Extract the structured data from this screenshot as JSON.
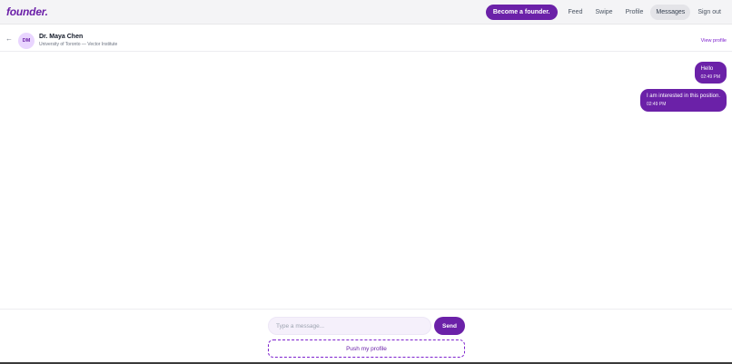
{
  "brand": {
    "logo": "founder."
  },
  "nav": {
    "cta": "Become a founder.",
    "feed": "Feed",
    "swipe": "Swipe",
    "profile": "Profile",
    "messages": "Messages",
    "sign_out": "Sign out",
    "active": "Messages"
  },
  "chat_header": {
    "back": "←",
    "avatar_initials": "DM",
    "name": "Dr. Maya Chen",
    "subtitle": "University of Toronto — Vector Institute",
    "view_profile": "View profile"
  },
  "messages": [
    {
      "text": "Hello",
      "time": "02:49 PM",
      "from": "me"
    },
    {
      "text": "I am interested in this position.",
      "time": "02:49 PM",
      "from": "me"
    }
  ],
  "composer": {
    "placeholder": "Type a message...",
    "send_label": "Send",
    "push_label": "Push my profile"
  },
  "colors": {
    "brand": "#6b21a8",
    "brand_light": "#e9d5ff",
    "input_bg": "#f5f0fb"
  }
}
